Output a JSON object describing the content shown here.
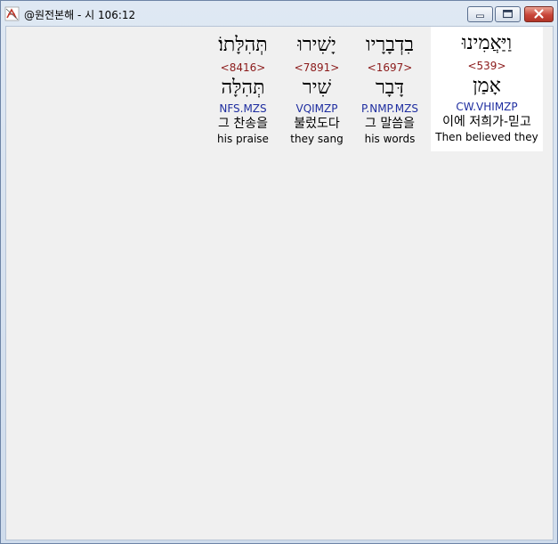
{
  "window": {
    "title": "@원전본해 - 시 106:12",
    "controls": {
      "minimize": "minimize-icon",
      "maximize": "maximize-icon",
      "close": "close-icon"
    }
  },
  "words": [
    {
      "hebrew": "וַיַּאֲמִינוּ",
      "strong": "<539>",
      "lemma": "אָמַן",
      "parse": "CW.VHIMZP",
      "korean": "이에 저희가-믿고",
      "english": "Then believed they"
    },
    {
      "hebrew": "בִדְבָרָיו",
      "strong": "<1697>",
      "lemma": "דָּבָר",
      "parse": "P.NMP.MZS",
      "korean": "그 말씀을",
      "english": "his words"
    },
    {
      "hebrew": "יָשִׁירוּ",
      "strong": "<7891>",
      "lemma": "שִׁיר",
      "parse": "VQIMZP",
      "korean": "불렀도다",
      "english": "they sang"
    },
    {
      "hebrew": "תְּהִלָּתוֹ׃",
      "strong": "<8416>",
      "lemma": "תְּהִלָּה",
      "parse": "NFS.MZS",
      "korean": "그 찬송을",
      "english": "his praise"
    }
  ]
}
